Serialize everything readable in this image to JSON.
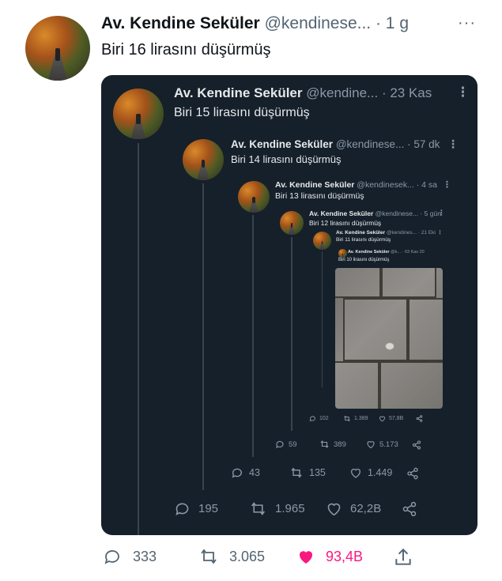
{
  "tweet": {
    "name": "Av. Kendine Seküler",
    "handle": "@kendinese...",
    "time": "· 1 g",
    "text": "Biri 16 lirasını düşürmüş",
    "actions": {
      "reply": "333",
      "retweet": "3.065",
      "like": "93,4B"
    },
    "like_color": "#f91880"
  },
  "q1": {
    "name": "Av. Kendine Seküler",
    "handle": "@kendine...",
    "time": "· 23 Kas",
    "text": "Biri 15 lirasını düşürmüş",
    "actions": {
      "reply": "195",
      "retweet": "1.965",
      "like": "62,2B"
    }
  },
  "q2": {
    "name": "Av. Kendine Seküler",
    "handle": "@kendinese...",
    "time": "· 57 dk",
    "text": "Biri 14 lirasını düşürmüş",
    "actions": {
      "reply": "43",
      "retweet": "135",
      "like": "1.449"
    }
  },
  "q3": {
    "name": "Av. Kendine Seküler",
    "handle": "@kendinesek...",
    "time": "· 4 sa",
    "text": "Biri 13 lirasını düşürmüş",
    "actions": {
      "reply": "59",
      "retweet": "389",
      "like": "5.173"
    }
  },
  "q4": {
    "name": "Av. Kendine Seküler",
    "handle": "@kendinese...",
    "time": "· 5 gün",
    "text": "Biri 12 lirasını düşürmüş",
    "actions": {
      "reply": "102",
      "retweet": "1.389",
      "like": "57,8B"
    }
  },
  "q5": {
    "name": "Av. Kendine Seküler",
    "handle": "@kendines...",
    "time": "· 21 Eki",
    "text": "Biri 11 lirasını düşürmüş"
  },
  "q6": {
    "name": "Av. Kendine Seküler",
    "handle": "@k...",
    "time": "· 03 Kas 20",
    "text": "Biri 10 lirasını düşürmüş"
  }
}
